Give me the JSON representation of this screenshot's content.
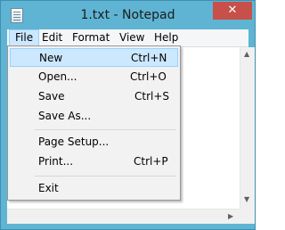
{
  "window": {
    "title": "1.txt - Notepad",
    "close_glyph": "✕"
  },
  "menubar": [
    "File",
    "Edit",
    "Format",
    "View",
    "Help"
  ],
  "file_menu": {
    "items": [
      {
        "label": "New",
        "shortcut": "Ctrl+N",
        "highlighted": true
      },
      {
        "label": "Open...",
        "shortcut": "Ctrl+O"
      },
      {
        "label": "Save",
        "shortcut": "Ctrl+S"
      },
      {
        "label": "Save As...",
        "shortcut": ""
      },
      {
        "label": "Page Setup...",
        "shortcut": ""
      },
      {
        "label": "Print...",
        "shortcut": "Ctrl+P"
      },
      {
        "label": "Exit",
        "shortcut": ""
      }
    ]
  },
  "icons": {
    "app": "notepad-icon",
    "close": "close-icon",
    "scroll_up": "scroll-up-arrow-icon",
    "scroll_down": "scroll-down-arrow-icon",
    "scroll_right": "scroll-right-arrow-icon"
  },
  "colors": {
    "titlebar": "#5fb4d3",
    "close_button": "#c7504a",
    "highlight": "#cce8ff",
    "highlight_border": "#99d1ff"
  }
}
